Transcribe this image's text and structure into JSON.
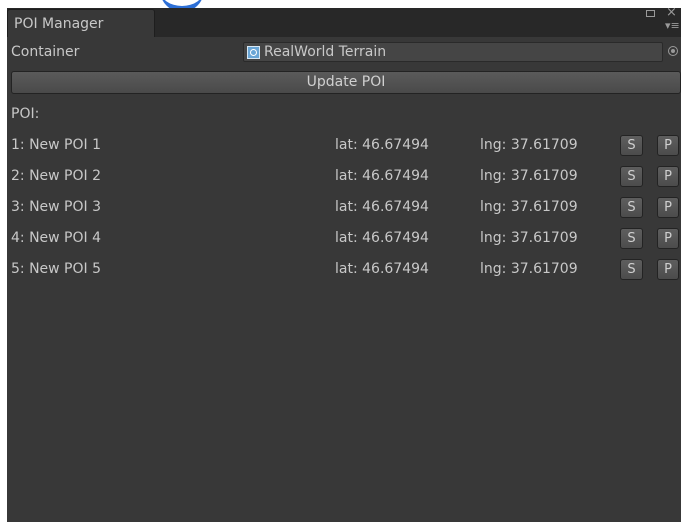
{
  "window": {
    "tab_title": "POI Manager",
    "close_glyph": "×",
    "menu_glyph": "▾≡"
  },
  "container": {
    "label": "Container",
    "value": "RealWorld Terrain",
    "icon": "terrain-object-icon"
  },
  "update_button": "Update POI",
  "poi_header": "POI:",
  "pois": [
    {
      "name": "1: New POI 1",
      "lat": "lat: 46.67494",
      "lng": "lng: 37.61709",
      "s": "S",
      "p": "P"
    },
    {
      "name": "2: New POI 2",
      "lat": "lat: 46.67494",
      "lng": "lng: 37.61709",
      "s": "S",
      "p": "P"
    },
    {
      "name": "3: New POI 3",
      "lat": "lat: 46.67494",
      "lng": "lng: 37.61709",
      "s": "S",
      "p": "P"
    },
    {
      "name": "4: New POI 4",
      "lat": "lat: 46.67494",
      "lng": "lng: 37.61709",
      "s": "S",
      "p": "P"
    },
    {
      "name": "5: New POI 5",
      "lat": "lat: 46.67494",
      "lng": "lng: 37.61709",
      "s": "S",
      "p": "P"
    }
  ],
  "colors": {
    "panel_bg": "#383838",
    "tabbar_bg": "#282828",
    "text": "#c8c8c8",
    "accent_blue": "#2d6fd6"
  }
}
